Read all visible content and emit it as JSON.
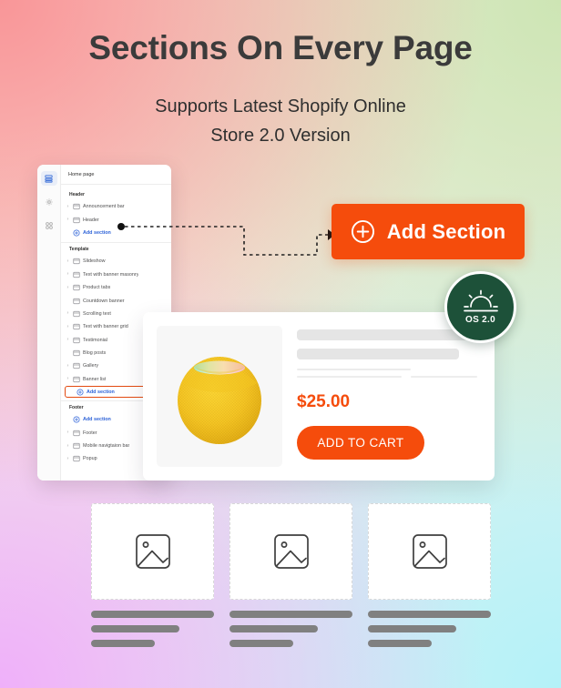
{
  "hero": {
    "headline": "Sections On Every Page",
    "subline_line1": "Supports Latest Shopify Online",
    "subline_line2": "Store 2.0 Version"
  },
  "colors": {
    "accent_orange": "#f54c0c",
    "link_blue": "#2e63d8",
    "badge_green": "#1d5139",
    "heading": "#3b3b3b"
  },
  "editor": {
    "rail": [
      {
        "name": "sections-icon",
        "active": true
      },
      {
        "name": "settings-gear-icon",
        "active": false
      },
      {
        "name": "apps-icon",
        "active": false
      }
    ],
    "page_title": "Home page",
    "groups": [
      {
        "title": "Header",
        "items": [
          {
            "label": "Announcement bar",
            "caret": true,
            "type": "section"
          },
          {
            "label": "Header",
            "caret": true,
            "type": "section"
          },
          {
            "label": "Add section",
            "caret": false,
            "type": "add"
          }
        ]
      },
      {
        "title": "Template",
        "items": [
          {
            "label": "Slideshow",
            "caret": true,
            "type": "section"
          },
          {
            "label": "Text with banner masonry",
            "caret": true,
            "type": "section"
          },
          {
            "label": "Product tabs",
            "caret": true,
            "type": "section"
          },
          {
            "label": "Countdown banner",
            "caret": false,
            "type": "section"
          },
          {
            "label": "Scrolling text",
            "caret": true,
            "type": "section"
          },
          {
            "label": "Text with banner grid",
            "caret": true,
            "type": "section"
          },
          {
            "label": "Testimonial",
            "caret": true,
            "type": "section"
          },
          {
            "label": "Blog posts",
            "caret": false,
            "type": "section"
          },
          {
            "label": "Gallery",
            "caret": true,
            "type": "section"
          },
          {
            "label": "Banner list",
            "caret": true,
            "type": "section"
          },
          {
            "label": "Add section",
            "caret": false,
            "type": "add-highlighted"
          }
        ]
      },
      {
        "title": "Footer",
        "items": [
          {
            "label": "Add section",
            "caret": false,
            "type": "add"
          },
          {
            "label": "Footer",
            "caret": true,
            "type": "section"
          },
          {
            "label": "Mobile navigtaion bar",
            "caret": true,
            "type": "section"
          },
          {
            "label": "Popup",
            "caret": true,
            "type": "section"
          }
        ]
      }
    ]
  },
  "cta": {
    "label": "Add Section",
    "icon": "plus-circle-icon"
  },
  "product": {
    "image_alt": "yellow-smart-speaker",
    "price": "$25.00",
    "add_to_cart_label": "ADD TO CART"
  },
  "badge": {
    "text": "OS 2.0",
    "icon": "sunrise-icon"
  },
  "placeholder_cards": [
    {
      "icon": "image-placeholder-icon"
    },
    {
      "icon": "image-placeholder-icon"
    },
    {
      "icon": "image-placeholder-icon"
    }
  ]
}
